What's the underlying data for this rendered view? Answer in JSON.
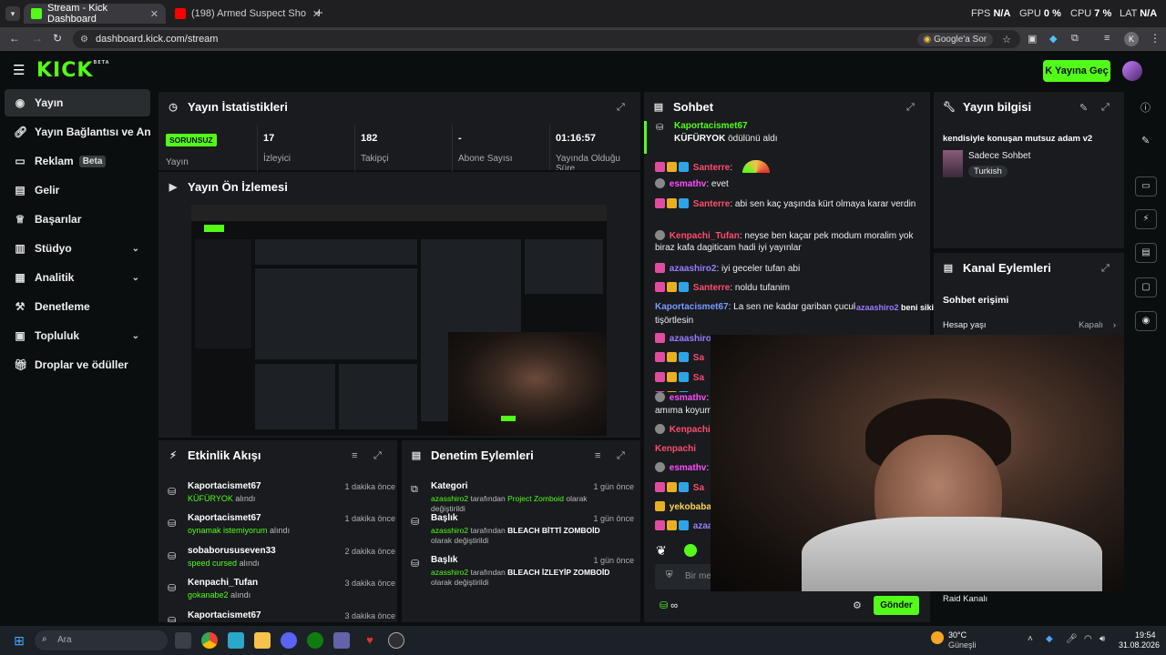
{
  "browser": {
    "tabs": [
      {
        "title": "Stream - Kick Dashboard",
        "active": true
      },
      {
        "title": "(198) Armed Suspect Shot After",
        "active": false
      }
    ],
    "new_tab": "+",
    "address": "dashboard.kick.com/stream",
    "google_btn": "Google'a Sor",
    "avatar_letter": "K"
  },
  "perf": {
    "fps_label": "FPS",
    "fps": "N/A",
    "gpu_label": "GPU",
    "gpu": "0 %",
    "cpu_label": "CPU",
    "cpu": "7 %",
    "lat_label": "LAT",
    "lat": "N/A"
  },
  "header": {
    "logo": "KICK",
    "logo_sup": "BETA",
    "go_live": "Yayına Geç"
  },
  "sidebar": {
    "items": [
      {
        "label": "Yayın",
        "icon": "broadcast-icon"
      },
      {
        "label": "Yayın Bağlantısı ve Anahtarı",
        "icon": "link-icon"
      },
      {
        "label": "Reklam",
        "icon": "ad-icon",
        "badge": "Beta"
      },
      {
        "label": "Gelir",
        "icon": "wallet-icon"
      },
      {
        "label": "Başarılar",
        "icon": "trophy-icon"
      },
      {
        "label": "Stüdyo",
        "icon": "studio-icon"
      },
      {
        "label": "Analitik",
        "icon": "analytics-icon"
      },
      {
        "label": "Denetleme",
        "icon": "hammer-icon"
      },
      {
        "label": "Topluluk",
        "icon": "community-icon"
      },
      {
        "label": "Droplar ve ödüller",
        "icon": "gift-icon"
      }
    ]
  },
  "stats": {
    "title": "Yayın İstatistikleri",
    "status": "SORUNSUZ",
    "status_label": "Yayın",
    "cells": [
      {
        "value": "17",
        "label": "İzleyici"
      },
      {
        "value": "182",
        "label": "Takipçi"
      },
      {
        "value": "-",
        "label": "Abone Sayısı"
      },
      {
        "value": "01:16:57",
        "label": "Yayında Olduğu Süre"
      }
    ]
  },
  "preview": {
    "title": "Yayın Ön İzlemesi"
  },
  "activity": {
    "title": "Etkinlik Akışı",
    "items": [
      {
        "name": "Kaportacismet67",
        "reward": "KÜFÜRYOK",
        "suffix": "alındı",
        "time": "1 dakika önce"
      },
      {
        "name": "Kaportacismet67",
        "reward": "oynamak istemiyorum",
        "suffix": "alındı",
        "time": "1 dakika önce"
      },
      {
        "name": "sobaborususeven33",
        "reward": "speed cursed",
        "suffix": "alındı",
        "time": "2 dakika önce"
      },
      {
        "name": "Kenpachi_Tufan",
        "reward": "gokanabe2",
        "suffix": "alındı",
        "time": "3 dakika önce"
      },
      {
        "name": "Kaportacismet67",
        "reward": "",
        "suffix": "",
        "time": "3 dakika önce"
      }
    ]
  },
  "moderation": {
    "title": "Denetim Eylemleri",
    "items": [
      {
        "title": "Kategori",
        "user": "azasshiro2",
        "mid": "tarafından",
        "value": "Project Zomboid",
        "end": "olarak değiştirildi",
        "time": "1 gün önce"
      },
      {
        "title": "Başlık",
        "user": "azasshiro2",
        "mid": "tarafından",
        "value": "BLEACH BİTTİ ZOMBOİD",
        "end": "olarak değiştirildi",
        "time": "1 gün önce"
      },
      {
        "title": "Başlık",
        "user": "azasshiro2",
        "mid": "tarafından",
        "value": "BLEACH İZLEYİP ZOMBOİD",
        "end": "olarak değiştirildi",
        "time": "1 gün önce"
      }
    ]
  },
  "chat": {
    "title": "Sohbet",
    "pinned_user": "Kaportacismet67",
    "pinned_reward": "KÜFÜRYOK",
    "pinned_text": "ödülünü aldı",
    "messages": [
      {
        "user": "Santerre",
        "color": "#ff4d6d",
        "text": ""
      },
      {
        "user": "esmathv",
        "color": "#ff4dff",
        "text": "evet"
      },
      {
        "user": "Santerre",
        "color": "#ff4d6d",
        "text": "abi sen kaç yaşında kürt olmaya karar verdin"
      },
      {
        "user": "Kenpachi_Tufan",
        "color": "#ff4d6d",
        "text": "neyse ben kaçar pek modum moralim yok biraz kafa dagiticam hadi iyi yayınlar"
      },
      {
        "user": "azaashiro2",
        "color": "#9b7bff",
        "text": "iyi geceler tufan abi"
      },
      {
        "user": "Santerre",
        "color": "#ff4d6d",
        "text": "noldu tufanim"
      },
      {
        "user": "Kaportacismet67",
        "color": "#7a9bff",
        "text": "La sen ne kadar gariban çucuksun"
      },
      {
        "user": "azaashiro",
        "color": "#9b7bff",
        "text": ""
      },
      {
        "user": "Sa",
        "color": "#ff4d6d",
        "text": ""
      },
      {
        "user": "Sa",
        "color": "#ff4d6d",
        "text": ""
      },
      {
        "user": "Sa",
        "color": "#ff4d6d",
        "text": ""
      },
      {
        "user": "esmathv",
        "color": "#ff4dff",
        "text": ""
      },
      {
        "user": "Kenpachi",
        "color": "#ff4d6d",
        "text": ""
      },
      {
        "user": "Kenpachi",
        "color": "#ff4d6d",
        "text": ""
      },
      {
        "user": "esmathv",
        "color": "#ff4dff",
        "text": ""
      },
      {
        "user": "Sa",
        "color": "#ff4d6d",
        "text": ""
      },
      {
        "user": "yekobaba",
        "color": "#ffd84d",
        "text": ""
      },
      {
        "user": "azaashiro",
        "color": "#9b7bff",
        "text": ""
      }
    ],
    "mention_overlay": "azaashiro2",
    "mention_text": "beni sikin yazılı japon tshirt",
    "continuation": "tişörtlesin",
    "amima": "amıma koyum",
    "input_placeholder": "Bir me",
    "send": "Gönder"
  },
  "stream_info": {
    "title": "Yayın bilgisi",
    "stream_title": "kendisiyle konuşan mutsuz adam v2",
    "category": "Sadece Sohbet",
    "language": "Turkish"
  },
  "channel_actions": {
    "title": "Kanal Eylemleri",
    "section": "Sohbet erişimi",
    "row_label": "Hesap yaşı",
    "row_value": "Kapalı",
    "raid": "Raid Kanalı"
  },
  "taskbar": {
    "search_placeholder": "Ara",
    "weather_temp": "30°C",
    "weather_text": "Güneşli",
    "time": "19:54",
    "date": "31.08.2026"
  },
  "colors": {
    "accent": "#53fc18",
    "panel": "#191b1f",
    "background": "#0b0e0f"
  }
}
